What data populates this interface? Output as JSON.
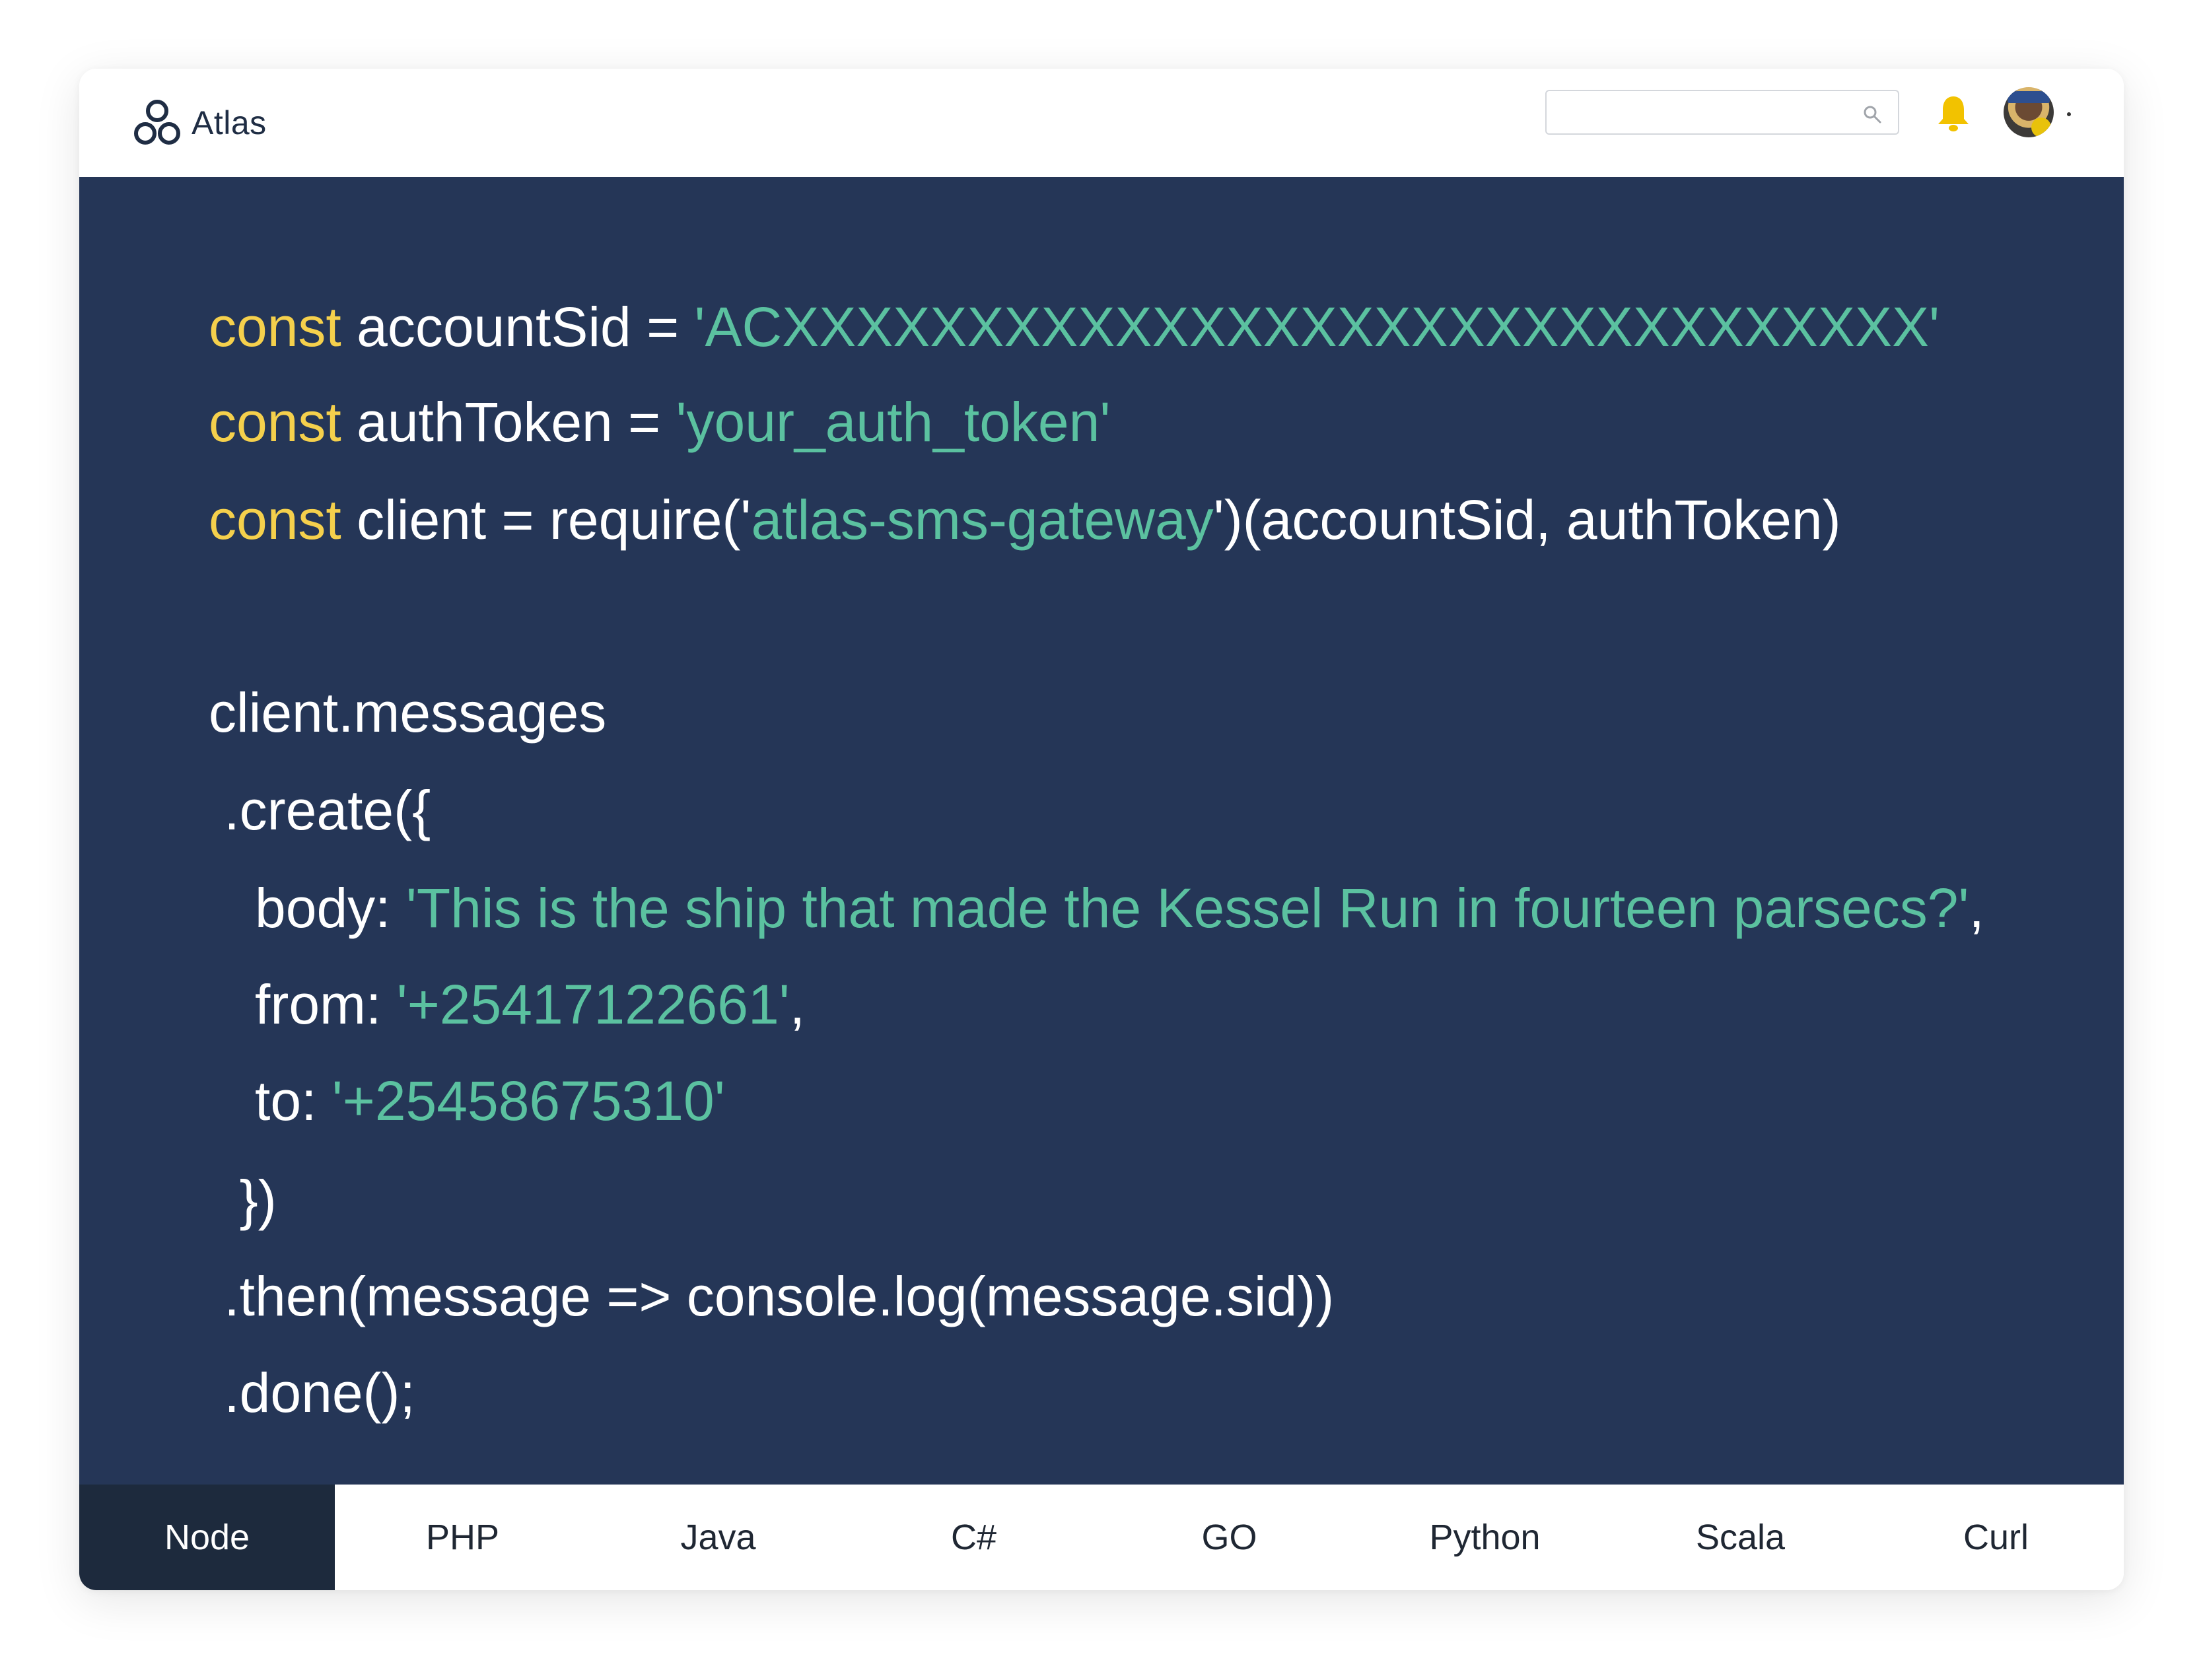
{
  "app": {
    "name": "Atlas"
  },
  "search": {
    "placeholder": "",
    "value": ""
  },
  "icons": {
    "logo": "atlas-logo-icon",
    "search": "search-icon",
    "notification": "bell-icon"
  },
  "colors": {
    "code_bg": "#253657",
    "keyword": "#f5d04c",
    "string": "#5bc1a0",
    "active_tab": "#1d2a3d",
    "bell": "#f2c200"
  },
  "code": {
    "line1": {
      "kw": "const",
      "plain1": " accountSid = ",
      "str": "'ACXXXXXXXXXXXXXXXXXXXXXXXXXXXXXXX'"
    },
    "line2": {
      "kw": "const",
      "plain1": " authToken = ",
      "str": "'your_auth_token'"
    },
    "line3": {
      "kw": "const",
      "plain1": " client = require('",
      "str": "atlas-sms-gateway",
      "plain2": "')(accountSid, authToken)"
    },
    "line4": {
      "plain": "client.messages"
    },
    "line5": {
      "plain": " .create({"
    },
    "line6": {
      "plain1": "   body: ",
      "str": "'This is the ship that made the Kessel Run in fourteen parsecs?'",
      "plain2": ","
    },
    "line7": {
      "plain1": "   from: ",
      "str": "'+25417122661'",
      "plain2": ","
    },
    "line8": {
      "plain1": "   to: ",
      "str": "'+25458675310'"
    },
    "line9": {
      "plain": "  })"
    },
    "line10": {
      "plain": " .then(message => console.log(message.sid))"
    },
    "line11": {
      "plain": " .done();"
    }
  },
  "tabs": [
    {
      "label": "Node",
      "active": true
    },
    {
      "label": "PHP",
      "active": false
    },
    {
      "label": "Java",
      "active": false
    },
    {
      "label": "C#",
      "active": false
    },
    {
      "label": "GO",
      "active": false
    },
    {
      "label": "Python",
      "active": false
    },
    {
      "label": "Scala",
      "active": false
    },
    {
      "label": "Curl",
      "active": false
    }
  ]
}
